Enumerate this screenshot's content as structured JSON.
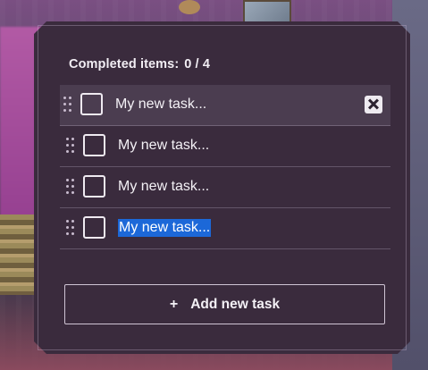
{
  "completed": {
    "label": "Completed items:",
    "count": "0 / 4"
  },
  "tasks": [
    {
      "text": "My new task...",
      "checked": false,
      "hovered": true,
      "selected": false
    },
    {
      "text": "My new task...",
      "checked": false,
      "hovered": false,
      "selected": false
    },
    {
      "text": "My new task...",
      "checked": false,
      "hovered": false,
      "selected": false
    },
    {
      "text": "My new task...",
      "checked": false,
      "hovered": false,
      "selected": true
    }
  ],
  "add_button": {
    "icon": "+",
    "label": "Add new task"
  },
  "colors": {
    "panel": "#3a2b3d",
    "selection": "#1c68d8",
    "text": "#f4f1f6"
  }
}
